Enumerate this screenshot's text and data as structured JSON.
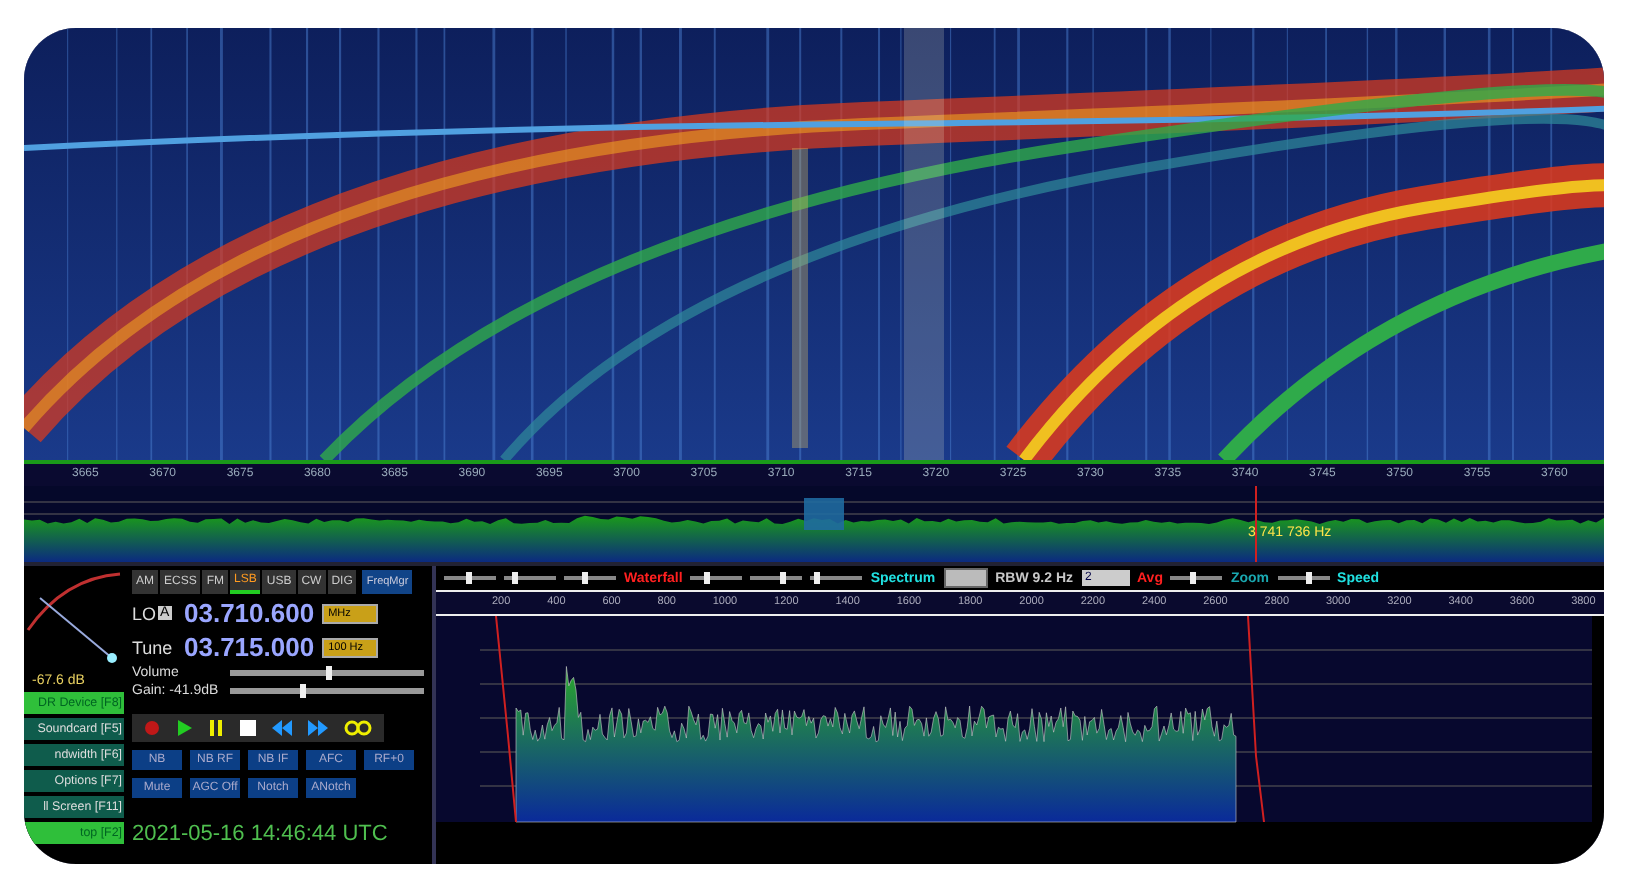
{
  "waterfall": {
    "scale": [
      "3665",
      "3670",
      "3675",
      "3680",
      "3685",
      "3690",
      "3695",
      "3700",
      "3705",
      "3710",
      "3715",
      "3720",
      "3725",
      "3730",
      "3735",
      "3740",
      "3745",
      "3750",
      "3755",
      "3760"
    ]
  },
  "overview": {
    "readout": "3 741 736 Hz"
  },
  "smeter": {
    "reading": "-67.6 dB"
  },
  "sidebar": {
    "items": [
      {
        "label": "DR Device [F8]",
        "active": true
      },
      {
        "label": "Soundcard [F5]",
        "active": false
      },
      {
        "label": "ndwidth [F6]",
        "active": false
      },
      {
        "label": "Options [F7]",
        "active": false
      },
      {
        "label": "ll Screen [F11]",
        "active": false
      },
      {
        "label": "top [F2]",
        "active": true
      }
    ]
  },
  "modes": [
    {
      "label": "AM",
      "selected": false
    },
    {
      "label": "ECSS",
      "selected": false
    },
    {
      "label": "FM",
      "selected": false
    },
    {
      "label": "LSB",
      "selected": true
    },
    {
      "label": "USB",
      "selected": false
    },
    {
      "label": "CW",
      "selected": false
    },
    {
      "label": "DIG",
      "selected": false
    }
  ],
  "freq_manager": "FreqMgr",
  "lo": {
    "label": "LO",
    "badge": "A",
    "value": "03.710.600",
    "unit": "MHz"
  },
  "tune": {
    "label": "Tune",
    "value": "03.715.000",
    "unit": "100 Hz"
  },
  "volume": {
    "label": "Volume",
    "level": 0.5
  },
  "gain": {
    "label": "Gain: -41.9dB",
    "level": 0.37
  },
  "dsp_buttons": [
    [
      "NB",
      "NB RF",
      "NB IF",
      "AFC",
      "RF+0"
    ],
    [
      "Mute",
      "AGC Off",
      "Notch",
      "ANotch"
    ]
  ],
  "clock": "2021-05-16  14:46:44 UTC",
  "spectrum": {
    "toolbar": [
      {
        "kind": "slider",
        "level": 0.45
      },
      {
        "kind": "slider",
        "level": 0.2
      },
      {
        "kind": "slider",
        "level": 0.4
      },
      {
        "kind": "label",
        "text": "Waterfall",
        "color": "#ff2020"
      },
      {
        "kind": "slider",
        "level": 0.3
      },
      {
        "kind": "slider",
        "level": 0.6
      },
      {
        "kind": "slider",
        "level": 0.1
      },
      {
        "kind": "label",
        "text": "Spectrum",
        "color": "#20e0e0"
      },
      {
        "kind": "spinner"
      },
      {
        "kind": "label",
        "text": "RBW  9.2 Hz",
        "color": "#c8c8c8"
      },
      {
        "kind": "dropdown",
        "text": "2"
      },
      {
        "kind": "label",
        "text": "Avg",
        "color": "#ff2020"
      },
      {
        "kind": "slider",
        "level": 0.4
      },
      {
        "kind": "label",
        "text": "Zoom",
        "color": "#1aa8b0"
      },
      {
        "kind": "slider",
        "level": 0.6
      },
      {
        "kind": "label",
        "text": "Speed",
        "color": "#20e0e0"
      }
    ],
    "xticks": [
      "200",
      "400",
      "600",
      "800",
      "1000",
      "1200",
      "1400",
      "1600",
      "1800",
      "2000",
      "2200",
      "2400",
      "2600",
      "2800",
      "3000",
      "3200",
      "3400",
      "3600",
      "3800"
    ]
  }
}
